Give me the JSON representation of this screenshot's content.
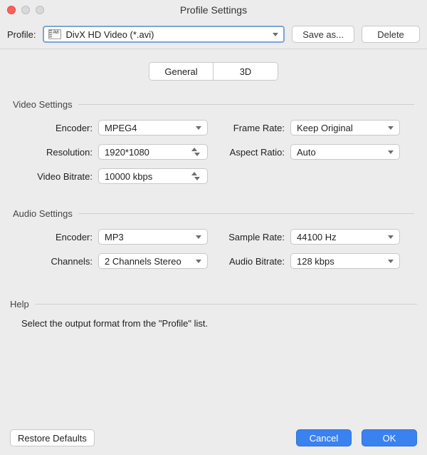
{
  "window": {
    "title": "Profile Settings"
  },
  "toolbar": {
    "profile_label": "Profile:",
    "profile_value": "DivX HD Video (*.avi)",
    "save_as_label": "Save as...",
    "delete_label": "Delete"
  },
  "tabs": {
    "general": "General",
    "threeD": "3D"
  },
  "video": {
    "section_title": "Video Settings",
    "encoder_label": "Encoder:",
    "encoder_value": "MPEG4",
    "resolution_label": "Resolution:",
    "resolution_value": "1920*1080",
    "bitrate_label": "Video Bitrate:",
    "bitrate_value": "10000 kbps",
    "frame_rate_label": "Frame Rate:",
    "frame_rate_value": "Keep Original",
    "aspect_label": "Aspect Ratio:",
    "aspect_value": "Auto"
  },
  "audio": {
    "section_title": "Audio Settings",
    "encoder_label": "Encoder:",
    "encoder_value": "MP3",
    "channels_label": "Channels:",
    "channels_value": "2 Channels Stereo",
    "sample_rate_label": "Sample Rate:",
    "sample_rate_value": "44100 Hz",
    "bitrate_label": "Audio Bitrate:",
    "bitrate_value": "128 kbps"
  },
  "help": {
    "title": "Help",
    "text": "Select the output format from the \"Profile\" list."
  },
  "footer": {
    "restore_label": "Restore Defaults",
    "cancel_label": "Cancel",
    "ok_label": "OK"
  }
}
